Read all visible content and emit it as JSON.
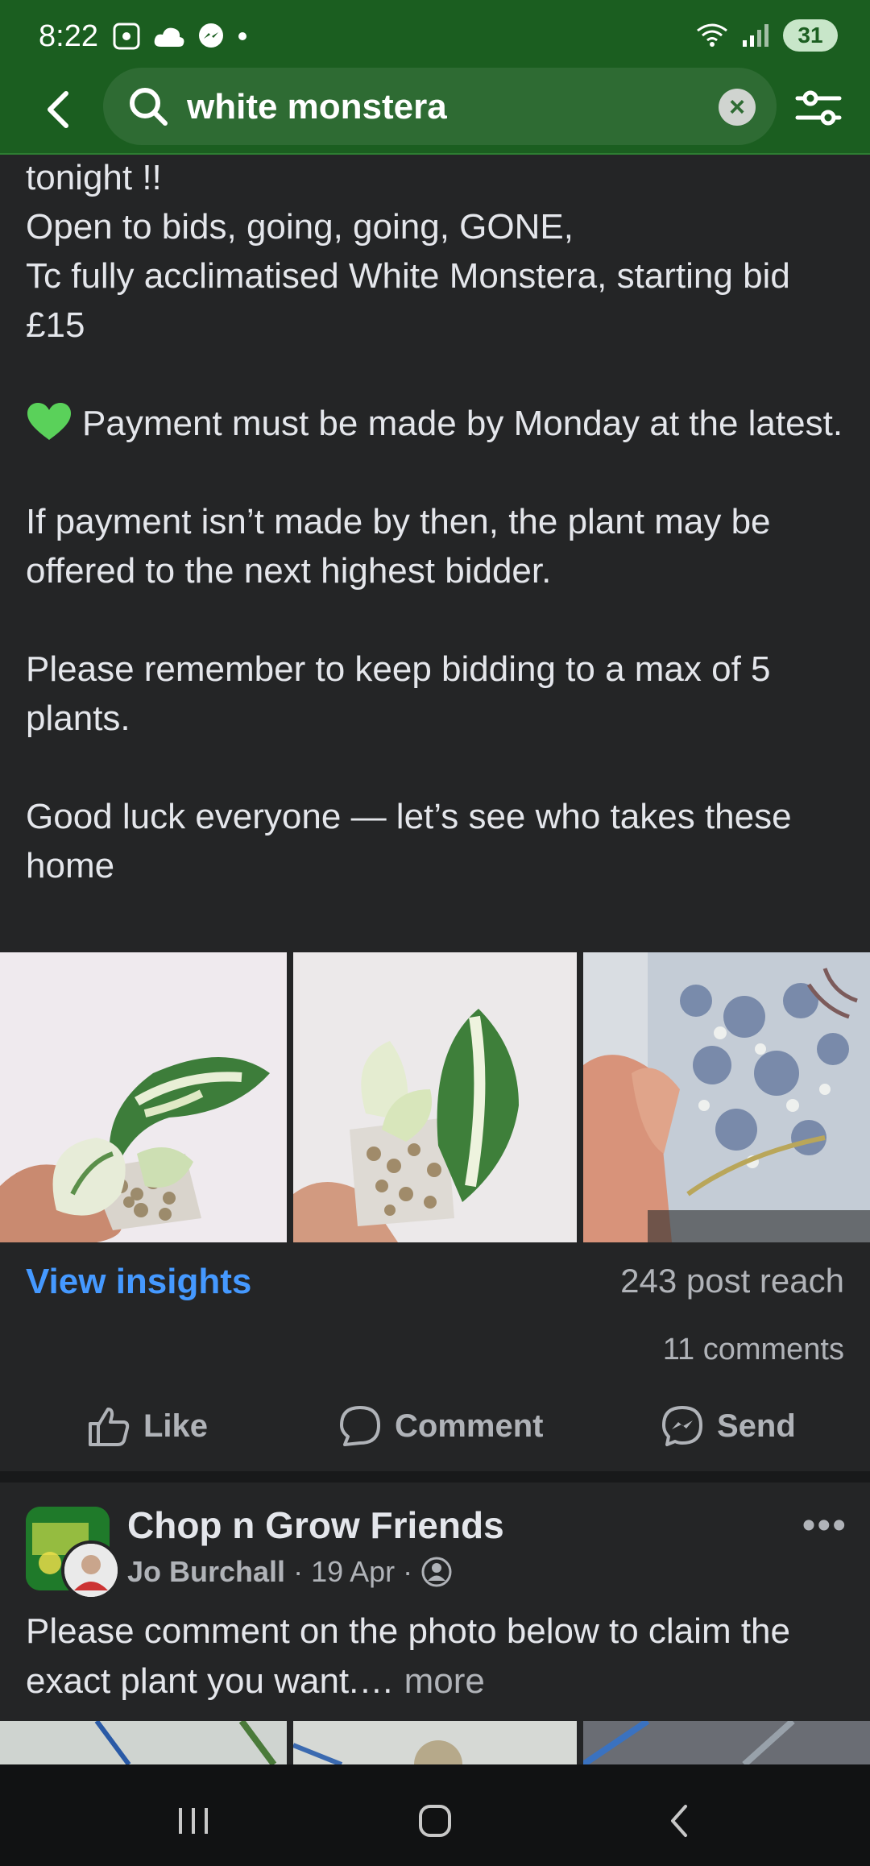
{
  "status_bar": {
    "time": "8:22",
    "battery": "31"
  },
  "search": {
    "query": "white monstera"
  },
  "post": {
    "lines": [
      "tonight !!",
      "Open to bids, going, going, GONE,",
      "Tc fully acclimatised White Monstera, starting bid £15",
      "Payment must be made by Monday at the latest.",
      "If payment isn’t made by then, the plant may be offered to the next highest bidder.",
      "Please remember to keep bidding to a max of 5 plants.",
      "Good luck everyone — let’s see who takes these home"
    ],
    "insights_label": "View insights",
    "reach": "243 post reach",
    "comments": "11 comments",
    "actions": {
      "like": "Like",
      "comment": "Comment",
      "send": "Send"
    }
  },
  "next_post": {
    "group_name": "Chop n Grow Friends",
    "author": "Jo Burchall",
    "date": "19 Apr",
    "text": "Please comment on the photo below to claim the exact plant you want.…",
    "more_label": "more"
  },
  "colors": {
    "header": "#1b5e20",
    "link": "#4599ff",
    "background": "#242526"
  }
}
